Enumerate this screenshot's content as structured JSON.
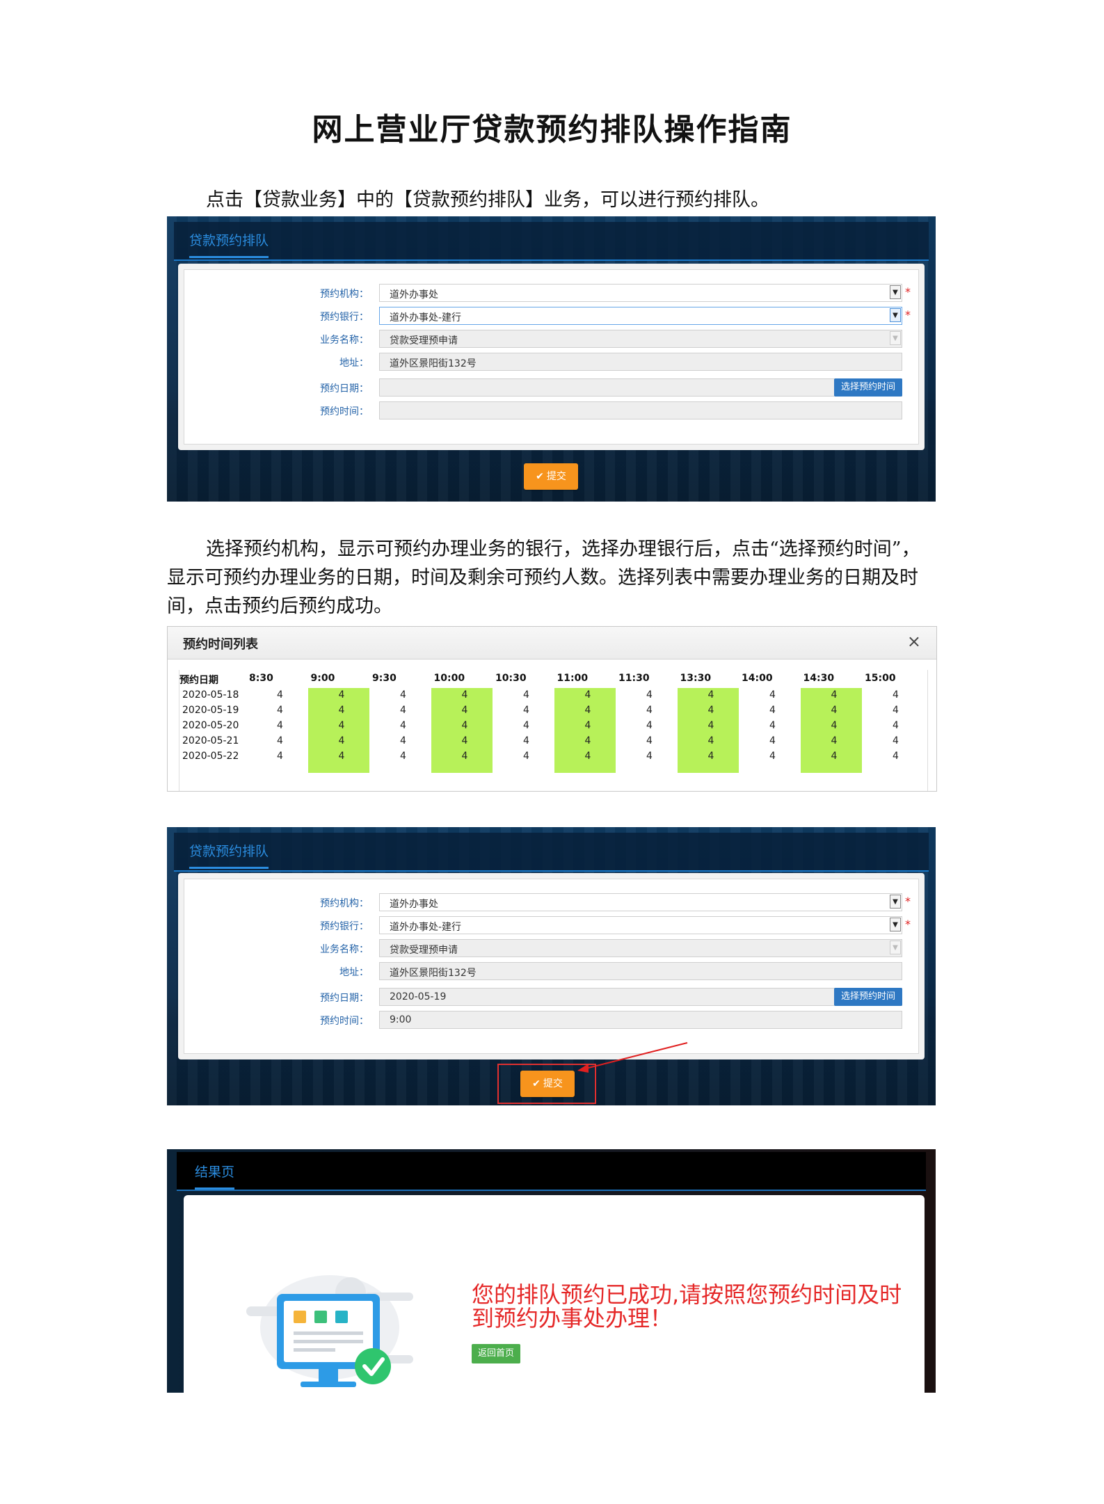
{
  "doc": {
    "title": "网上营业厅贷款预约排队操作指南",
    "para1": "点击【贷款业务】中的【贷款预约排队】业务，可以进行预约排队。",
    "para2_line1": "选择预约机构，显示可预约办理业务的银行，选择办理银行后，点击“选择预约时间”，",
    "para2_line2": "显示可预约办理业务的日期，时间及剩余可预约人数。选择列表中需要办理业务的日期及时",
    "para2_line3": "间，点击预约后预约成功。"
  },
  "form1": {
    "tab": "贷款预约排队",
    "org_label": "预约机构：",
    "org_value": "道外办事处",
    "bank_label": "预约银行：",
    "bank_value": "道外办事处-建行",
    "biz_label": "业务名称：",
    "biz_value": "贷款受理预申请",
    "addr_label": "地址：",
    "addr_value": "道外区景阳街132号",
    "date_label": "预约日期：",
    "date_value": "",
    "time_label": "预约时间：",
    "time_value": "",
    "pick_button": "选择预约时间",
    "required_mark": "*",
    "submit": "提交"
  },
  "timetable": {
    "title": "预约时间列表",
    "close": "×",
    "date_header": "预约日期",
    "slots": [
      "8:30",
      "9:00",
      "9:30",
      "10:00",
      "10:30",
      "11:00",
      "11:30",
      "13:30",
      "14:00",
      "14:30",
      "15:00"
    ],
    "dates": [
      "2020-05-18",
      "2020-05-19",
      "2020-05-20",
      "2020-05-21",
      "2020-05-22"
    ],
    "counts": [
      [
        4,
        4,
        4,
        4,
        4,
        4,
        4,
        4,
        4,
        4,
        4
      ],
      [
        4,
        4,
        4,
        4,
        4,
        4,
        4,
        4,
        4,
        4,
        4
      ],
      [
        4,
        4,
        4,
        4,
        4,
        4,
        4,
        4,
        4,
        4,
        4
      ],
      [
        4,
        4,
        4,
        4,
        4,
        4,
        4,
        4,
        4,
        4,
        4
      ],
      [
        4,
        4,
        4,
        4,
        4,
        4,
        4,
        4,
        4,
        4,
        4
      ]
    ],
    "highlight_color": "#b7f159"
  },
  "form2": {
    "tab": "贷款预约排队",
    "org_label": "预约机构：",
    "org_value": "道外办事处",
    "bank_label": "预约银行：",
    "bank_value": "道外办事处-建行",
    "biz_label": "业务名称：",
    "biz_value": "贷款受理预申请",
    "addr_label": "地址：",
    "addr_value": "道外区景阳街132号",
    "date_label": "预约日期：",
    "date_value": "2020-05-19",
    "time_label": "预约时间：",
    "time_value": "9:00",
    "pick_button": "选择预约时间",
    "required_mark": "*",
    "submit": "提交"
  },
  "result": {
    "tab": "结果页",
    "message": "您的排队预约已成功,请按照您预约时间及时到预约办事处办理！",
    "back_button": "返回首页"
  },
  "colors": {
    "accent_blue": "#2b8de0",
    "submit_orange": "#f7941d",
    "success_green": "#4cae4c",
    "error_red": "#e52828"
  }
}
